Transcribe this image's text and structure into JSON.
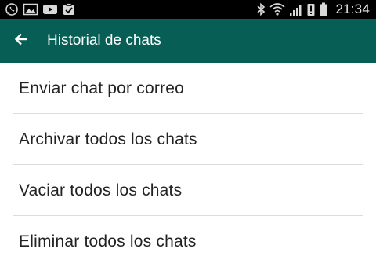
{
  "status_bar": {
    "time": "21:34",
    "left_icons": [
      "whatsapp-icon",
      "gallery-icon",
      "youtube-icon",
      "clipboard-check-icon"
    ],
    "right_icons": [
      "bluetooth-icon",
      "wifi-icon",
      "signal-icon",
      "alert-icon",
      "battery-icon"
    ]
  },
  "app_bar": {
    "title": "Historial de chats",
    "back_icon": "arrow-back-icon",
    "color": "#075e54"
  },
  "menu": {
    "items": [
      {
        "label": "Enviar chat por correo"
      },
      {
        "label": "Archivar todos los chats"
      },
      {
        "label": "Vaciar todos los chats"
      },
      {
        "label": "Eliminar todos los chats"
      }
    ]
  }
}
